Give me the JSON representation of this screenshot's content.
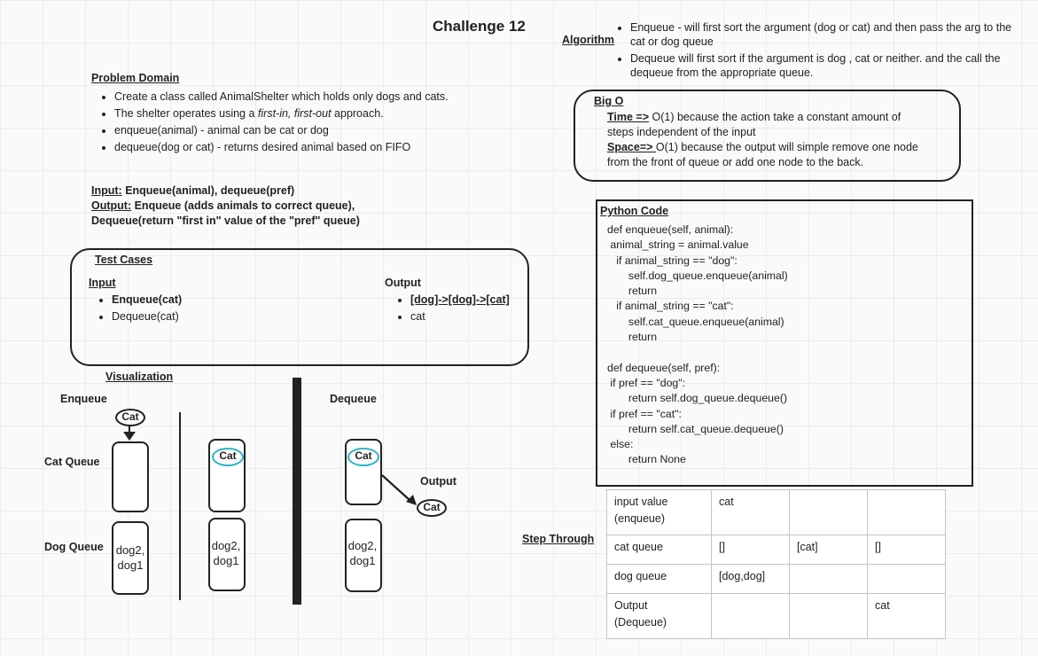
{
  "title": "Challenge 12",
  "algorithm": {
    "heading": "Algorithm",
    "items": [
      "Enqueue - will first sort the argument (dog or cat) and then pass the arg to the cat or dog queue",
      "Dequeue will first sort if the argument is dog , cat or neither. and the call the dequeue from the appropriate queue."
    ]
  },
  "problem_domain": {
    "heading": "Problem Domain",
    "items": [
      {
        "pre": "Create a class called AnimalShelter which holds only dogs and cats.",
        "em": "",
        "post": ""
      },
      {
        "pre": "The shelter operates using a ",
        "em": "first-in, first-out",
        "post": " approach."
      },
      {
        "pre": "enqueue(animal) - animal can be cat or dog",
        "em": "",
        "post": ""
      },
      {
        "pre": "dequeue(dog or cat) - returns desired animal based on FIFO",
        "em": "",
        "post": ""
      }
    ]
  },
  "io": {
    "input_label": "Input:",
    "input_value": " Enqueue(animal), dequeue(pref)",
    "output_label": "Output:",
    "output_value": " Enqueue (adds animals to correct queue),",
    "output_value2": "Dequeue(return \"first in\" value of the \"pref\" queue)"
  },
  "test_cases": {
    "heading": "Test Cases",
    "input_heading": "Input",
    "inputs": [
      "Enqueue(cat)",
      "Dequeue(cat)"
    ],
    "output_heading": "Output",
    "outputs": [
      "[dog]->[dog]->[cat]",
      "cat"
    ]
  },
  "big_o": {
    "heading": "Big O",
    "time_label": "Time =>",
    "time_text": " O(1)  because the action take a constant amount of",
    "time_text2": "steps independent of the input",
    "space_label": "Space=> ",
    "space_text": " O(1) because the output will simple remove one node",
    "space_text2": "from the front of queue or add one node to the back."
  },
  "python_code": {
    "heading": "Python Code",
    "lines": [
      "def enqueue(self, animal):",
      " animal_string = animal.value",
      "   if animal_string == \"dog\":",
      "       self.dog_queue.enqueue(animal)",
      "       return",
      "   if animal_string == \"cat\":",
      "       self.cat_queue.enqueue(animal)",
      "       return",
      "",
      "def dequeue(self, pref):",
      " if pref == \"dog\":",
      "       return self.dog_queue.dequeue()",
      " if pref == \"cat\":",
      "       return self.cat_queue.dequeue()",
      " else:",
      "       return None"
    ]
  },
  "visualization": {
    "heading": "Visualization",
    "enqueue_label": "Enqueue",
    "dequeue_label": "Dequeue",
    "cat_queue_label": "Cat Queue",
    "dog_queue_label": "Dog Queue",
    "output_label": "Output",
    "cat": "Cat",
    "dogs_line1": "dog2,",
    "dogs_line2": "dog1"
  },
  "step_through": {
    "heading": "Step Through",
    "rows": [
      [
        "input value\n(enqueue)",
        "cat",
        "",
        ""
      ],
      [
        "cat queue",
        "[]",
        "[cat]",
        "[]"
      ],
      [
        "dog queue",
        "[dog,dog]",
        "",
        ""
      ],
      [
        "Output\n(Dequeue)",
        "",
        "",
        "cat"
      ]
    ]
  }
}
